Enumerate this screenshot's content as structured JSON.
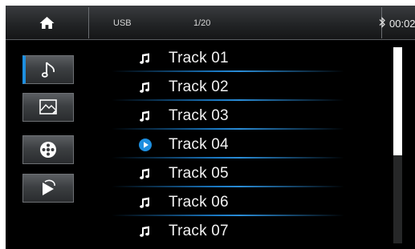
{
  "status_bar": {
    "source": "USB",
    "track_counter": "1/20",
    "time": "00:02",
    "icons": [
      "home-icon",
      "bluetooth-icon"
    ]
  },
  "sidebar": {
    "items": [
      {
        "name": "music",
        "icon": "music-note-icon",
        "active": true
      },
      {
        "name": "photo",
        "icon": "picture-icon",
        "active": false
      },
      {
        "name": "video",
        "icon": "film-reel-icon",
        "active": false
      },
      {
        "name": "other",
        "icon": "play-swirl-icon",
        "active": false
      }
    ]
  },
  "tracks": [
    {
      "title": "Track 01",
      "icon": "music-note-icon",
      "playing": false
    },
    {
      "title": "Track 02",
      "icon": "music-note-icon",
      "playing": false
    },
    {
      "title": "Track 03",
      "icon": "music-note-icon",
      "playing": false
    },
    {
      "title": "Track 04",
      "icon": "play-circle-icon",
      "playing": true
    },
    {
      "title": "Track 05",
      "icon": "music-note-icon",
      "playing": false
    },
    {
      "title": "Track 06",
      "icon": "music-note-icon",
      "playing": false
    },
    {
      "title": "Track 07",
      "icon": "music-note-icon",
      "playing": false
    }
  ],
  "scrollbar": {
    "visible_fraction": 0.55
  },
  "colors": {
    "accent": "#1d8fe0",
    "background": "#000000",
    "separator": "#1a78c2",
    "text": "#f2f2f2"
  }
}
